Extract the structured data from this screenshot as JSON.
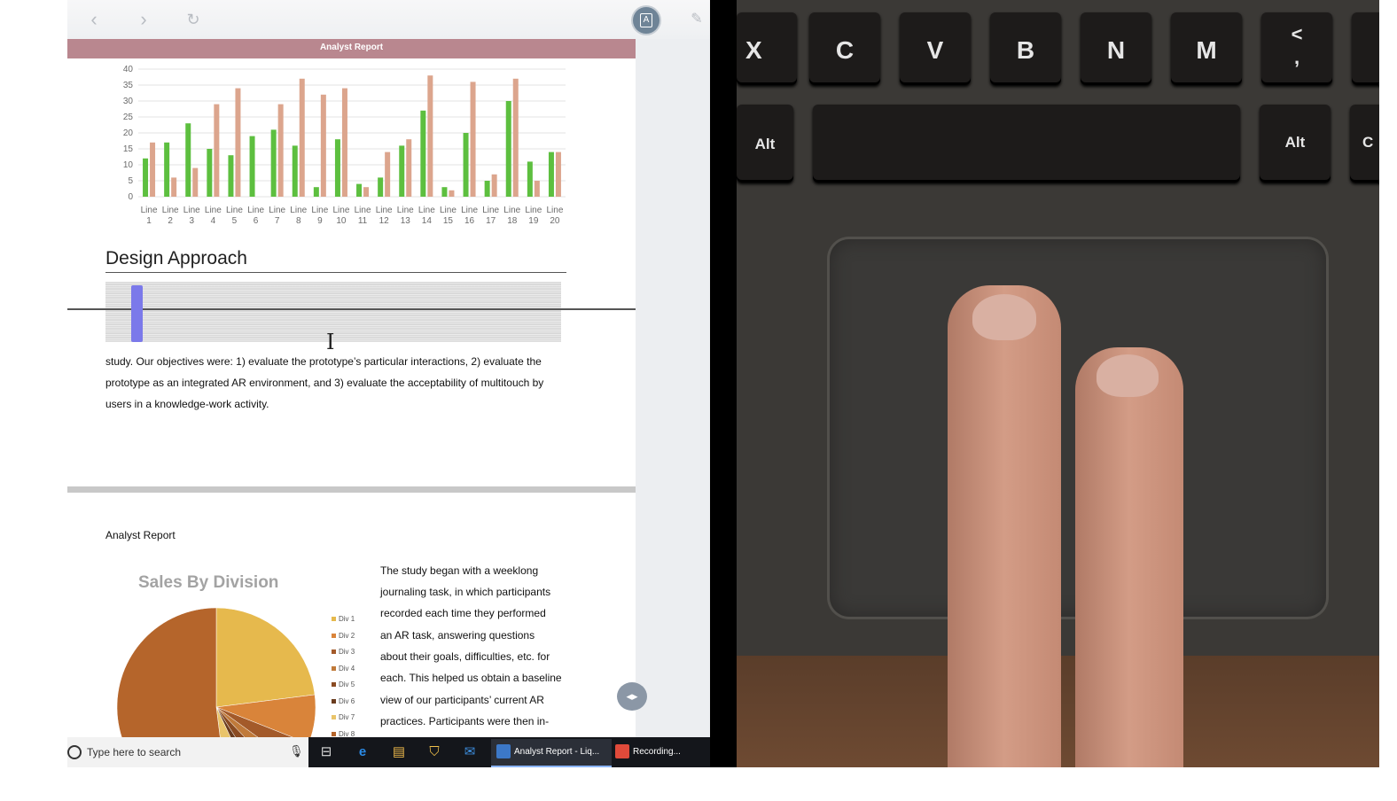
{
  "toolbar": {
    "back_glyph": "‹",
    "forward_glyph": "›",
    "refresh_glyph": "↻",
    "pen_glyph": "✎",
    "avatar_glyph": "A"
  },
  "document": {
    "banner_title": "Analyst Report",
    "heading": "Design Approach",
    "paragraph_lines": [
      "study. Our objectives were: 1) evaluate the prototype’s particular interactions, 2) evaluate the",
      "prototype as an integrated AR environment, and 3) evaluate the acceptability of multitouch by",
      "users in a knowledge-work activity."
    ],
    "page2_title": "Analyst Report",
    "pie_title": "Sales By Division",
    "legend": [
      "Div 1",
      "Div 2",
      "Div 3",
      "Div 4",
      "Div 5",
      "Div 6",
      "Div 7",
      "Div 8"
    ],
    "column_lines": [
      "The study began with a weeklong",
      "journaling task, in which participants",
      "recorded each time they performed",
      "an AR task, answering questions",
      "about their goals, difficulties, etc. for",
      "each. This helped us obtain a baseline",
      "view of our participants’ current AR",
      "practices. Participants were then in-"
    ]
  },
  "colors": {
    "series_a": "#5dbf3f",
    "series_b": "#dca58d",
    "banner": "#b9878f",
    "handle": "#7b79ea",
    "legend": [
      "#e6b94d",
      "#d9843a",
      "#a35a2a",
      "#c07a3a",
      "#8a4b22",
      "#6a3c1e",
      "#e9c46a",
      "#b5652b"
    ]
  },
  "chart_data": [
    {
      "type": "bar",
      "categories": [
        "Line 1",
        "Line 2",
        "Line 3",
        "Line 4",
        "Line 5",
        "Line 6",
        "Line 7",
        "Line 8",
        "Line 9",
        "Line 10",
        "Line 11",
        "Line 12",
        "Line 13",
        "Line 14",
        "Line 15",
        "Line 16",
        "Line 17",
        "Line 18",
        "Line 19",
        "Line 20"
      ],
      "series": [
        {
          "values": [
            12,
            17,
            23,
            15,
            13,
            19,
            21,
            16,
            3,
            18,
            4,
            6,
            16,
            27,
            3,
            20,
            5,
            30,
            11,
            14
          ]
        },
        {
          "values": [
            17,
            6,
            9,
            29,
            34,
            0,
            29,
            37,
            32,
            34,
            3,
            14,
            18,
            38,
            2,
            36,
            7,
            37,
            5,
            14
          ]
        }
      ],
      "y_ticks": [
        0,
        5,
        10,
        15,
        20,
        25,
        30,
        35,
        40
      ],
      "ylim": [
        0,
        40
      ],
      "grid": true
    },
    {
      "type": "pie",
      "title": "Sales By Division",
      "categories": [
        "Div 1",
        "Div 2",
        "Div 3",
        "Div 4",
        "Div 5",
        "Div 6",
        "Div 7",
        "Div 8"
      ],
      "values": [
        23,
        8,
        4,
        3,
        3,
        2,
        5,
        52
      ]
    }
  ],
  "taskbar": {
    "search_placeholder": "Type here to search",
    "apps": [
      {
        "label": "Analyst Report - Liq..."
      },
      {
        "label": "Recording..."
      }
    ]
  },
  "keyboard": {
    "row1": [
      "X",
      "C",
      "V",
      "B",
      "N",
      "M"
    ],
    "lt_comma_top": "<",
    "lt_comma_bottom": ",",
    "alt_left": "Alt",
    "alt_right": "Alt",
    "partial_right": "C"
  }
}
